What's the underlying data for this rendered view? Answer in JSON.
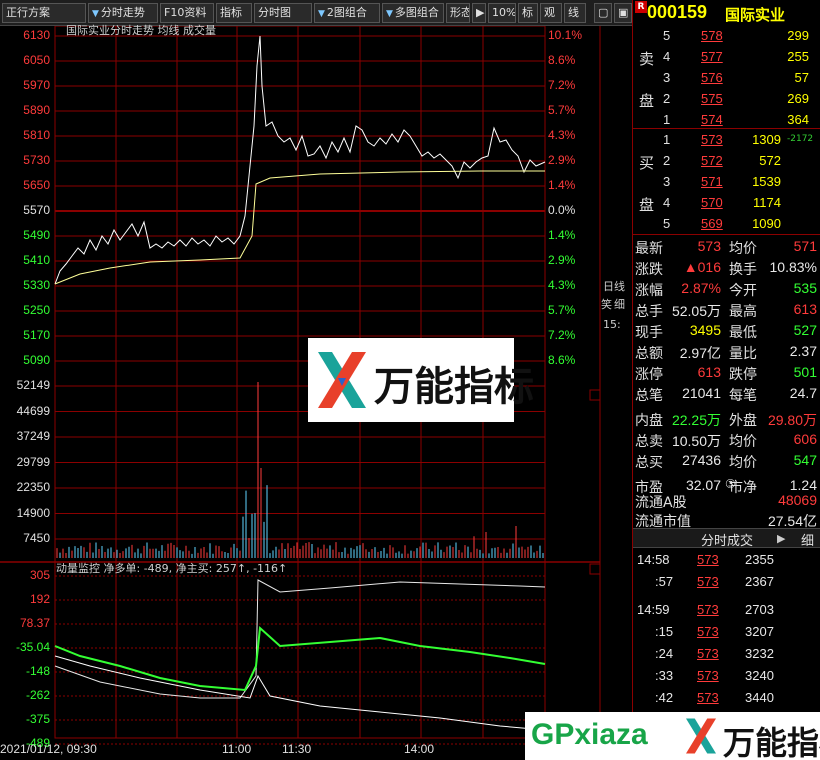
{
  "toolbar": {
    "items": [
      {
        "label": "正行方案",
        "dropdown": false
      },
      {
        "label": "分时走势",
        "dropdown": true
      },
      {
        "label": "F10资料",
        "dropdown": false
      },
      {
        "label": "指标",
        "dropdown": false
      },
      {
        "label": "分时图",
        "dropdown": false
      },
      {
        "label": "2图组合",
        "dropdown": true
      },
      {
        "label": "多图组合",
        "dropdown": true
      },
      {
        "label": "形态",
        "dropdown": false
      },
      {
        "label": "▶",
        "dropdown": false
      },
      {
        "label": "10%",
        "dropdown": false
      },
      {
        "label": "标",
        "dropdown": false
      },
      {
        "label": "观",
        "dropdown": false
      },
      {
        "label": "线",
        "dropdown": false
      }
    ]
  },
  "chart": {
    "title": "国际实业分时走势  均线  成交量",
    "monitor_title": "动量监控  净多单: -489, 净主买: 257↑, -116↑",
    "price_labels": [
      "6130",
      "6050",
      "5970",
      "5890",
      "5810",
      "5730",
      "5650",
      "5570",
      "5490",
      "5410",
      "5330",
      "5250",
      "5170",
      "5090"
    ],
    "pct_labels": [
      "10.1%",
      "8.6%",
      "7.2%",
      "5.7%",
      "4.3%",
      "2.9%",
      "1.4%",
      "0.0%",
      "1.4%",
      "2.9%",
      "4.3%",
      "5.7%",
      "7.2%",
      "8.6%"
    ],
    "volume_labels": [
      "52149",
      "44699",
      "37249",
      "29799",
      "22350",
      "14900",
      "7450"
    ],
    "monitor_labels": [
      "305",
      "192",
      "78.37",
      "-35.04",
      "-148",
      "-262",
      "-375",
      "-489"
    ],
    "time_labels": [
      "2021/01/12, 09:30",
      "11:00",
      "11:30",
      "14:00"
    ],
    "side_tabs": [
      "日线",
      "笑",
      "细",
      "15:"
    ],
    "colors": {
      "up": "#ff3b3b",
      "down": "#33ff33",
      "price_line": "#ffffff",
      "avg_line": "#ffff99",
      "grid": "#8b0000"
    }
  },
  "quote": {
    "badge": "R",
    "code": "000159",
    "name": "国际实业",
    "sell_label_1": "卖",
    "sell_label_2": "盘",
    "buy_label_1": "买",
    "buy_label_2": "盘",
    "asks": [
      {
        "level": "5",
        "price": "578",
        "volume": "299"
      },
      {
        "level": "4",
        "price": "577",
        "volume": "255"
      },
      {
        "level": "3",
        "price": "576",
        "volume": "57"
      },
      {
        "level": "2",
        "price": "575",
        "volume": "269"
      },
      {
        "level": "1",
        "price": "574",
        "volume": "364"
      }
    ],
    "bids": [
      {
        "level": "1",
        "price": "573",
        "volume": "1309"
      },
      {
        "level": "2",
        "price": "572",
        "volume": "572"
      },
      {
        "level": "3",
        "price": "571",
        "volume": "1539"
      },
      {
        "level": "4",
        "price": "570",
        "volume": "1174"
      },
      {
        "level": "5",
        "price": "569",
        "volume": "1090"
      }
    ],
    "bid_delta": "-2172",
    "stats": [
      {
        "l1": "最新",
        "v1": "573",
        "c1": "red",
        "l2": "均价",
        "v2": "571",
        "c2": "red"
      },
      {
        "l1": "涨跌",
        "v1": "▲016",
        "c1": "red",
        "l2": "换手",
        "v2": "10.83%",
        "c2": "white"
      },
      {
        "l1": "涨幅",
        "v1": "2.87%",
        "c1": "red",
        "l2": "今开",
        "v2": "535",
        "c2": "green"
      },
      {
        "l1": "总手",
        "v1": "52.05万",
        "c1": "white",
        "l2": "最高",
        "v2": "613",
        "c2": "red"
      },
      {
        "l1": "现手",
        "v1": "3495",
        "c1": "yellow",
        "l2": "最低",
        "v2": "527",
        "c2": "green"
      },
      {
        "l1": "总额",
        "v1": "2.97亿",
        "c1": "white",
        "l2": "量比",
        "v2": "2.37",
        "c2": "white"
      },
      {
        "l1": "涨停",
        "v1": "613",
        "c1": "red",
        "l2": "跌停",
        "v2": "501",
        "c2": "green"
      },
      {
        "l1": "总笔",
        "v1": "21041",
        "c1": "white",
        "l2": "每笔",
        "v2": "24.7",
        "c2": "white"
      },
      {
        "l1": "内盘",
        "v1": "22.25万",
        "c1": "green",
        "l2": "外盘",
        "v2": "29.80万",
        "c2": "red"
      },
      {
        "l1": "总卖",
        "v1": "10.50万",
        "c1": "white",
        "l2": "均价",
        "v2": "606",
        "c2": "red"
      },
      {
        "l1": "总买",
        "v1": "27436",
        "c1": "white",
        "l2": "均价",
        "v2": "547",
        "c2": "green"
      },
      {
        "l1": "市盈",
        "v1": "32.07",
        "c1": "white",
        "l2": "市净",
        "v2": "1.24",
        "c2": "white"
      }
    ],
    "pe_marker": "③",
    "float_shares_label": "流通A股",
    "float_shares_value": "48069",
    "float_mcap_label": "流通市值",
    "float_mcap_value": "27.54亿",
    "ticks_title": "分时成交",
    "ticks_detail": "细",
    "ticks": [
      {
        "time": "14:58",
        "price": "573",
        "volume": "2355"
      },
      {
        "time": ":57",
        "price": "573",
        "volume": "2367"
      },
      {
        "time": "14:59",
        "price": "573",
        "volume": "2703"
      },
      {
        "time": ":15",
        "price": "573",
        "volume": "3207"
      },
      {
        "time": ":24",
        "price": "573",
        "volume": "3232"
      },
      {
        "time": ":33",
        "price": "573",
        "volume": "3240"
      },
      {
        "time": ":42",
        "price": "573",
        "volume": "3440"
      }
    ]
  },
  "watermark": {
    "center_text": "万能指标",
    "bottom_site": "GPxiaza",
    "bottom_text": "万能指标"
  }
}
